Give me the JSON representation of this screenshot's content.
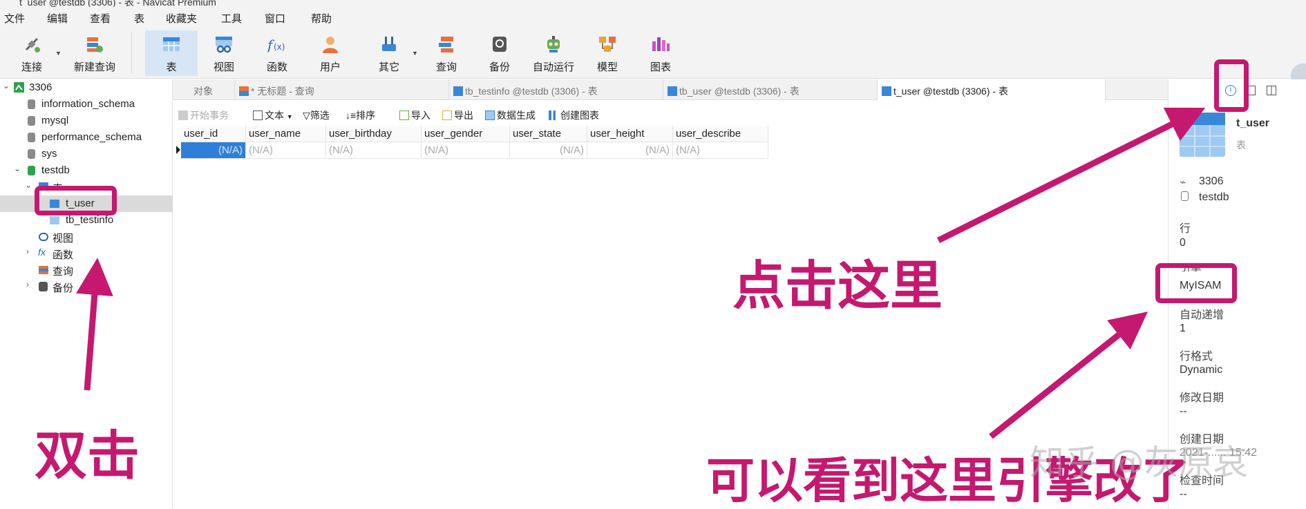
{
  "window": {
    "title": "t_user @testdb (3306) - 表 - Navicat Premium"
  },
  "menu": [
    "文件",
    "编辑",
    "查看",
    "表",
    "收藏夹",
    "工具",
    "窗口",
    "帮助"
  ],
  "toolbar": {
    "connect": "连接",
    "new_query": "新建查询",
    "table": "表",
    "view": "视图",
    "function": "函数",
    "user": "用户",
    "other": "其它",
    "query": "查询",
    "backup": "备份",
    "autorun": "自动运行",
    "model": "模型",
    "chart": "图表"
  },
  "sidebar": {
    "connection": "3306",
    "databases": [
      "information_schema",
      "mysql",
      "performance_schema",
      "sys",
      "testdb"
    ],
    "table_group": "表",
    "tables": [
      "t_user",
      "tb_testinfo"
    ],
    "view": "视图",
    "function": "函数",
    "query": "查询",
    "backup": "备份"
  },
  "tabs": {
    "objects": "对象",
    "untitled": "* 无标题 - 查询",
    "tb_testinfo": "tb_testinfo @testdb (3306) - 表",
    "tb_user": "tb_user @testdb (3306) - 表",
    "t_user": "t_user @testdb (3306) - 表"
  },
  "actions": {
    "begin_tx": "开始事务",
    "text": "文本",
    "filter": "筛选",
    "sort": "排序",
    "import": "导入",
    "export": "导出",
    "data_gen": "数据生成",
    "create_chart": "创建图表"
  },
  "grid": {
    "columns": [
      "user_id",
      "user_name",
      "user_birthday",
      "user_gender",
      "user_state",
      "user_height",
      "user_describe"
    ],
    "row": [
      "(N/A)",
      "(N/A)",
      "(N/A)",
      "(N/A)",
      "(N/A)",
      "(N/A)",
      "(N/A)"
    ]
  },
  "info": {
    "name": "t_user",
    "type": "表",
    "connection": "3306",
    "database": "testdb",
    "rows_label": "行",
    "rows": "0",
    "engine_label": "引擎",
    "engine": "MyISAM",
    "auto_inc_label": "自动递增",
    "auto_inc": "1",
    "row_format_label": "行格式",
    "row_format": "Dynamic",
    "modified_label": "修改日期",
    "modified": "--",
    "created_label": "创建日期",
    "created": "2021-...... 15:42",
    "check_label": "检查时间",
    "check": "--"
  },
  "annotations": {
    "double_click": "双击",
    "click_here": "点击这里",
    "engine_hint": "可以看到这里引擎改了"
  },
  "watermark": "知乎 @灰原哀",
  "colors": {
    "highlight": "#c5186f",
    "active_tab": "#d6e6f5",
    "selection": "#2f7fd8"
  }
}
